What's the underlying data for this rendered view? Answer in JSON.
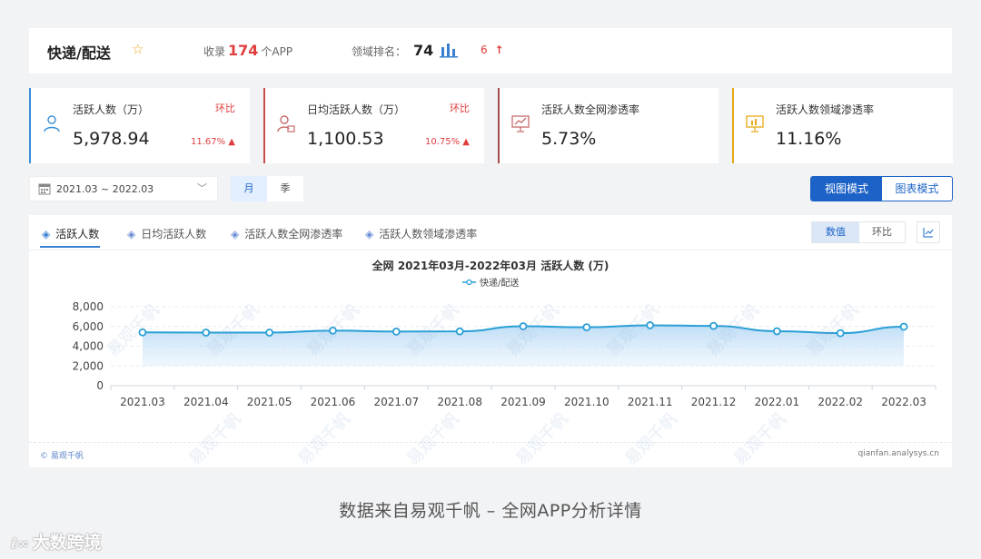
{
  "header": {
    "title": "快递/配送",
    "collect_prefix": "收录",
    "collect_count": "174",
    "collect_suffix": "个APP",
    "rank_label": "领域排名：",
    "rank_value": "74",
    "rank_change": "6"
  },
  "metrics": [
    {
      "label": "活跃人数（万）",
      "value": "5,978.94",
      "huanbi_label": "环比",
      "delta": "11.67%",
      "accent": "#3a8fd8"
    },
    {
      "label": "日均活跃人数（万）",
      "value": "1,100.53",
      "huanbi_label": "环比",
      "delta": "10.75%",
      "accent": "#c84c4c"
    },
    {
      "label": "活跃人数全网渗透率",
      "value": "5.73%",
      "accent": "#a44a4a"
    },
    {
      "label": "活跃人数领域渗透率",
      "value": "11.16%",
      "accent": "#e6a817"
    }
  ],
  "controls": {
    "date_range": "2021.03 ~ 2022.03",
    "period_month": "月",
    "period_quarter": "季",
    "mode_view": "视图模式",
    "mode_chart": "图表模式"
  },
  "tabs": [
    {
      "label": "活跃人数"
    },
    {
      "label": "日均活跃人数"
    },
    {
      "label": "活跃人数全网渗透率"
    },
    {
      "label": "活跃人数领域渗透率"
    }
  ],
  "value_switch": {
    "active": "数值",
    "inactive": "环比"
  },
  "chart_data": {
    "type": "line",
    "title": "全网 2021年03月-2022年03月 活跃人数 (万)",
    "legend_position": "top-center",
    "categories": [
      "2021.03",
      "2021.04",
      "2021.05",
      "2021.06",
      "2021.07",
      "2021.08",
      "2021.09",
      "2021.10",
      "2021.11",
      "2021.12",
      "2022.01",
      "2022.02",
      "2022.03"
    ],
    "series": [
      {
        "name": "快递/配送",
        "color": "#2a9fd6",
        "values": [
          5400,
          5380,
          5380,
          5580,
          5480,
          5500,
          6020,
          5920,
          6120,
          6060,
          5520,
          5320,
          5979
        ]
      }
    ],
    "y_ticks": [
      "8,000",
      "6,000",
      "4,000",
      "2,000",
      "0"
    ],
    "ylim": [
      0,
      8000
    ],
    "grid": true
  },
  "footer": {
    "copyright": "© 易观千帆",
    "source": "qianfan.analysys.cn"
  },
  "caption": "数据来自易观千帆 – 全网APP分析详情",
  "brand": "大数跨境"
}
